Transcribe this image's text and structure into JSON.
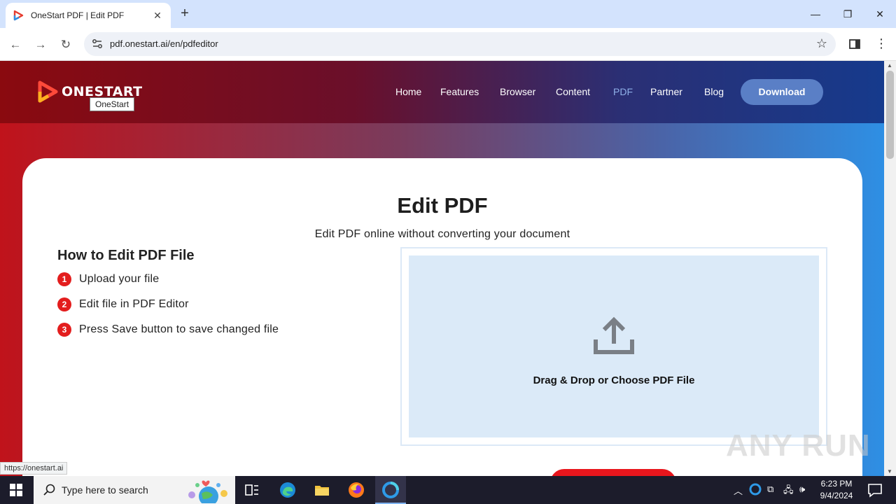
{
  "browser": {
    "tab_title": "OneStart PDF | Edit PDF",
    "url": "pdf.onestart.ai/en/pdfeditor",
    "status_url": "https://onestart.ai"
  },
  "header": {
    "logo_text": "ONESTART",
    "logo_tooltip": "OneStart",
    "nav": [
      "Home",
      "Features",
      "Browser",
      "Content",
      "PDF",
      "Partner",
      "Blog"
    ],
    "active_nav": "PDF",
    "download_label": "Download"
  },
  "main": {
    "title": "Edit PDF",
    "subtitle": "Edit PDF online without converting your document",
    "howto_title": "How to Edit PDF File",
    "steps": [
      {
        "num": "1",
        "text": "Upload your file"
      },
      {
        "num": "2",
        "text": "Edit file in PDF Editor"
      },
      {
        "num": "3",
        "text": "Press Save button to save changed file"
      }
    ],
    "drop_text": "Drag & Drop or Choose PDF File"
  },
  "watermark": "ANY RUN",
  "taskbar": {
    "search_placeholder": "Type here to search",
    "time": "6:23 PM",
    "date": "9/4/2024"
  },
  "colors": {
    "accent_red": "#e31d1d",
    "download_blue": "#5a7fc6",
    "drop_zone": "#dbeaf8"
  }
}
